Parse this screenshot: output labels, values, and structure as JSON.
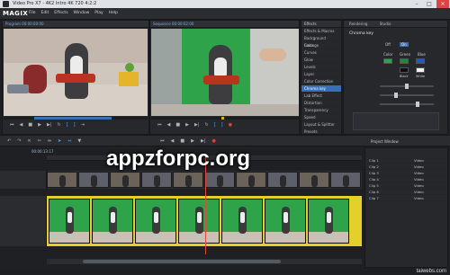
{
  "window": {
    "title": "Video Pro X7 - 4K2 Intro 4K 720 4:2:2"
  },
  "app": {
    "logo": "MAGIX"
  },
  "menu": [
    "File",
    "Edit",
    "Effects",
    "Window",
    "Play",
    "Help"
  ],
  "source_monitor": {
    "label": "Program 00:00:00:00"
  },
  "program_monitor": {
    "label": "Sequence 00:00:02:00"
  },
  "timecode": "00:00:13:17",
  "effects_panel": {
    "items": [
      "Effects & Macros",
      "Background Footage",
      "Color",
      "Curves",
      "Glow",
      "Levels",
      "Layer",
      "Color Correction",
      "Chroma key",
      "Lab Effect",
      "Distortion",
      "Transparency",
      "Speed",
      "Layout & Splitter",
      "Presets"
    ]
  },
  "properties_panel": {
    "title": "Chroma key",
    "tabs": [
      "Rendering",
      "Studio"
    ],
    "options": [
      "Off",
      "On",
      "Color",
      "Green",
      "Blue",
      "Black",
      "White"
    ],
    "key_color": "#2fa34a"
  },
  "watermark": "appzforpc.org",
  "project_window": {
    "title": "Project Window",
    "files": [
      "Clip 1",
      "Clip 2",
      "Clip 3",
      "Clip 4",
      "Clip 5",
      "Clip 6",
      "Clip 7"
    ],
    "types": [
      "Video",
      "Video",
      "Video",
      "Video",
      "Video",
      "Video",
      "Video"
    ]
  },
  "corner_mark": "taiwebs.com",
  "colors": {
    "accent": "#3a6fb5",
    "key_green": "#2fa34a",
    "timeline_yellow": "#e5cf2b"
  }
}
